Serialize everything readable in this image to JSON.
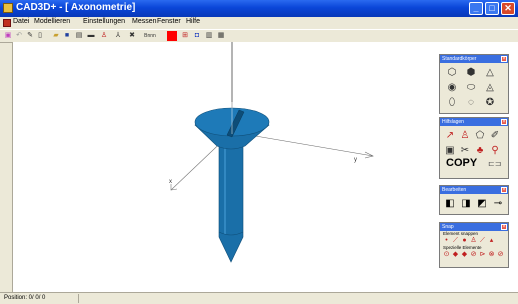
{
  "window": {
    "title": "CAD3D+ - [ Axonometrie]",
    "min_symbol": "_",
    "max_symbol": "□",
    "close_symbol": "✕"
  },
  "menu": {
    "items": [
      "Datei",
      "Modellieren",
      "Einstellungen",
      "Messen",
      "Fenster",
      "Hilfe"
    ]
  },
  "toolbar": {
    "buttons": [
      {
        "icon": "new-icon",
        "glyph": "▣"
      },
      {
        "icon": "undo-icon",
        "glyph": "↶"
      },
      {
        "icon": "pencil-icon",
        "glyph": "✎"
      },
      {
        "icon": "page-icon",
        "glyph": "▯"
      },
      {
        "icon": "open-folder-icon",
        "glyph": "▰"
      },
      {
        "icon": "save-icon",
        "glyph": "■"
      },
      {
        "icon": "print-icon",
        "glyph": "▤"
      },
      {
        "icon": "zoom-icon",
        "glyph": "▬"
      },
      {
        "icon": "figure-icon",
        "glyph": "♙"
      },
      {
        "icon": "axes-icon",
        "glyph": "⅄"
      },
      {
        "icon": "cross-icon",
        "glyph": "✖"
      },
      {
        "icon": "label-icon",
        "glyph": "Bnnn"
      },
      {
        "icon": "color-icon",
        "glyph": ""
      },
      {
        "icon": "grid-icon",
        "glyph": "⊞"
      },
      {
        "icon": "render-icon",
        "glyph": "◘"
      },
      {
        "icon": "view-icon",
        "glyph": "▥"
      },
      {
        "icon": "window-icon",
        "glyph": "▦"
      }
    ],
    "accent_color": "#ff0000"
  },
  "viewport": {
    "axis_y_label": "y",
    "axis_x_label": "x",
    "model_color": "#1a6fa8"
  },
  "panels": {
    "standard": {
      "title": "Standardkörper",
      "glyphs": [
        "⬡",
        "⬢",
        "△",
        "◉",
        "⬭",
        "◬",
        "⬯",
        "◌",
        "✪"
      ]
    },
    "hilfslagen": {
      "title": "Hilfslagen",
      "glyphs": [
        "↗",
        "♙",
        "⬠",
        "✐",
        "▣",
        "✂",
        "♣",
        "⚲"
      ],
      "copy_label": "COPY",
      "copy_glyph": "⊏⊐"
    },
    "bearbeiten": {
      "title": "Bearbeiten",
      "glyphs": [
        "◧",
        "◨",
        "◩",
        "⊸"
      ]
    },
    "snap": {
      "title": "Snap",
      "sub1": "Element snappen",
      "row1": [
        "•",
        "⟋",
        "●",
        "♙",
        "⟋",
        "▴"
      ],
      "sub2": "Spezielle Elemente",
      "row2": [
        "⊙",
        "◆",
        "◆",
        "⊘",
        "⊳",
        "⊗",
        "⊘"
      ]
    }
  },
  "status": {
    "position_text": "Position:  0/  0/  0"
  }
}
